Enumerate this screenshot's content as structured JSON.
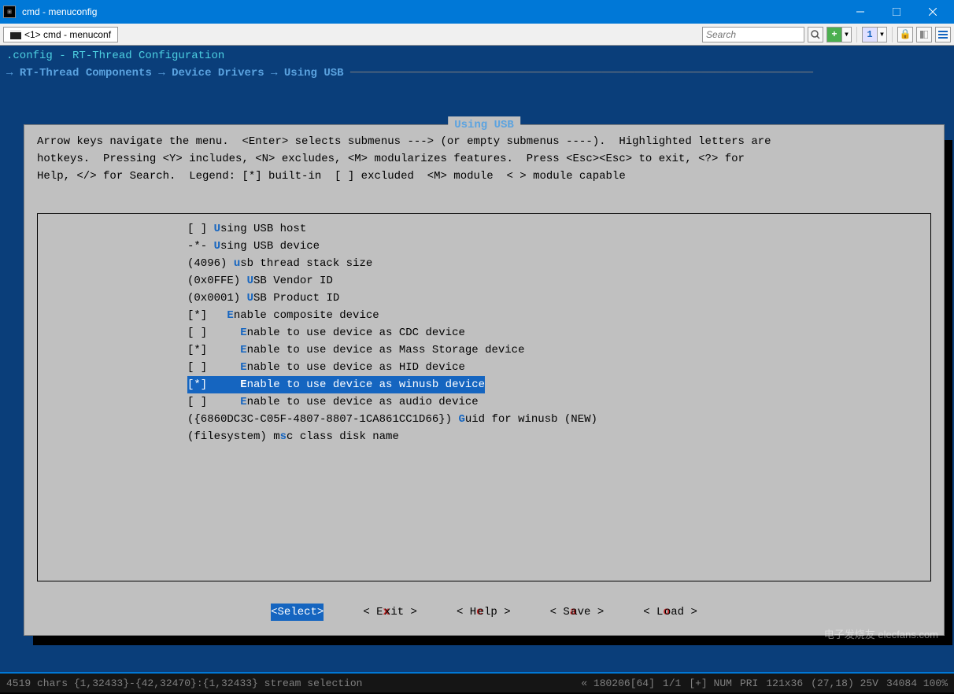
{
  "window": {
    "title": "cmd - menuconfig"
  },
  "tab": {
    "label": "<1> cmd - menuconf"
  },
  "search": {
    "placeholder": "Search"
  },
  "header": {
    "line1": ".config - RT-Thread Configuration",
    "crumb1": "RT-Thread Components",
    "crumb2": "Device Drivers",
    "crumb3": "Using USB"
  },
  "box": {
    "title": "Using USB",
    "help1": "Arrow keys navigate the menu.  <Enter> selects submenus ---> (or empty submenus ----).  Highlighted letters are",
    "help2": "hotkeys.  Pressing <Y> includes, <N> excludes, <M> modularizes features.  Press <Esc><Esc> to exit, <?> for",
    "help3": "Help, </> for Search.  Legend: [*] built-in  [ ] excluded  <M> module  < > module capable"
  },
  "menu": {
    "items": [
      {
        "prefix": "[ ] ",
        "hl": "U",
        "rest": "sing USB host",
        "indent": ""
      },
      {
        "prefix": "-*- ",
        "hl": "U",
        "rest": "sing USB device",
        "indent": ""
      },
      {
        "prefix": "(4096) ",
        "hl": "u",
        "rest": "sb thread stack size",
        "indent": ""
      },
      {
        "prefix": "(0x0FFE) ",
        "hl": "U",
        "rest": "SB Vendor ID",
        "indent": ""
      },
      {
        "prefix": "(0x0001) ",
        "hl": "U",
        "rest": "SB Product ID",
        "indent": ""
      },
      {
        "prefix": "[*]   ",
        "hl": "E",
        "rest": "nable composite device",
        "indent": ""
      },
      {
        "prefix": "[ ]     ",
        "hl": "E",
        "rest": "nable to use device as CDC device",
        "indent": ""
      },
      {
        "prefix": "[*]     ",
        "hl": "E",
        "rest": "nable to use device as Mass Storage device",
        "indent": ""
      },
      {
        "prefix": "[ ]     ",
        "hl": "E",
        "rest": "nable to use device as HID device",
        "indent": ""
      },
      {
        "prefix": "[*]     ",
        "hl": "E",
        "rest": "nable to use device as winusb device",
        "indent": "",
        "selected": true
      },
      {
        "prefix": "[ ]     ",
        "hl": "E",
        "rest": "nable to use device as audio device",
        "indent": ""
      },
      {
        "prefix": "({6860DC3C-C05F-4807-8807-1CA861CC1D66}) ",
        "hl": "G",
        "rest": "uid for winusb (NEW)",
        "indent": ""
      },
      {
        "prefix": "(filesystem) m",
        "hl": "s",
        "rest": "c class disk name",
        "indent": ""
      }
    ]
  },
  "buttons": {
    "select": "<Select>",
    "exit_l": "< E",
    "exit_r": "xit >",
    "help_l": "< H",
    "help_r": "elp >",
    "save_l": "< S",
    "save_r": "ave >",
    "load_l": "< L",
    "load_r": "oad >"
  },
  "status": {
    "left": "4519 chars {1,32433}-{42,32470}:{1,32433} stream selection",
    "r1": "« 180206[64]",
    "r2": "1/1",
    "r3": "[+] NUM",
    "r4": "PRI",
    "r5": "121x36",
    "r6": "(27,18) 25V",
    "r7": "34084 100%"
  },
  "watermark": "电子发烧友 elecfans.com"
}
